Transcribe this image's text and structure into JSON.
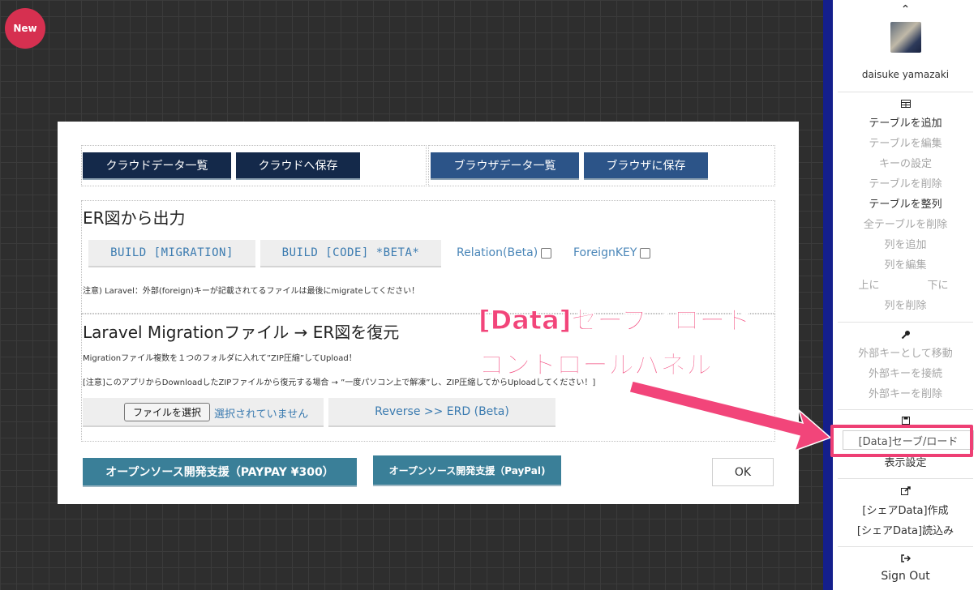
{
  "badge": "New",
  "modal": {
    "cloud_list_label": "クラウドデータ一覧",
    "cloud_save_label": "クラウドへ保存",
    "browser_list_label": "ブラウザデータ一覧",
    "browser_save_label": "ブラウザに保存",
    "export": {
      "title": "ER図から出力",
      "build_migration": "BUILD [MIGRATION]",
      "build_code": "BUILD [CODE] *BETA*",
      "relation_label": "Relation(Beta)",
      "foreignkey_label": "ForeignKEY",
      "note": "注意) Laravel：外部(foreign)キーが記載されてるファイルは最後にmigrateしてください！"
    },
    "restore": {
      "title": "Laravel Migrationファイル → ER図を復元",
      "note1": "Migrationファイル複数を１つのフォルダに入れて”ZIP圧縮”してUpload！",
      "note2": "[注意]このアプリからDownloadしたZIPファイルから復元する場合 → ”一度パソコン上で解凍”し、ZIP圧縮してからUploadしてください！]",
      "file_button": "ファイルを選択",
      "file_status": "選択されていません",
      "reverse_button": "Reverse >> ERD (Beta)"
    },
    "support_paypay": "オープンソース開発支援（PAYPAY ¥300）",
    "support_paypal": "オープンソース開発支援（PayPal)",
    "ok_label": "OK"
  },
  "callout": {
    "line1": "[Data]セーブ／ロード",
    "line2": "コントロールパネル"
  },
  "sidebar": {
    "collapse_icon": "chevron-up-icon",
    "username": "daisuke yamazaki",
    "table_icon": "table-icon",
    "items_table": [
      "テーブルを追加",
      "テーブルを編集",
      "キーの設定",
      "テーブルを削除",
      "テーブルを整列",
      "全テーブルを削除",
      "列を追加",
      "列を編集"
    ],
    "move_up": "上に",
    "move_down": "下に",
    "delete_column": "列を削除",
    "key_icon": "key-icon",
    "items_key": [
      "外部キーとして移動",
      "外部キーを接続",
      "外部キーを削除"
    ],
    "save_icon": "save-icon",
    "save_load": "[Data]セーブ/ロード",
    "display_settings": "表示設定",
    "share_icon": "share-icon",
    "share_create": "[シェアData]作成",
    "share_load": "[シェアData]読込み",
    "signout_icon": "sign-out-icon",
    "sign_out": "Sign Out"
  },
  "colors": {
    "navy_button": "#14294a",
    "blue_button": "#2c5488",
    "teal_button": "#3a7f98",
    "sidebar_border": "#141f8c",
    "highlight": "#ee3f74",
    "badge": "#d63050"
  }
}
